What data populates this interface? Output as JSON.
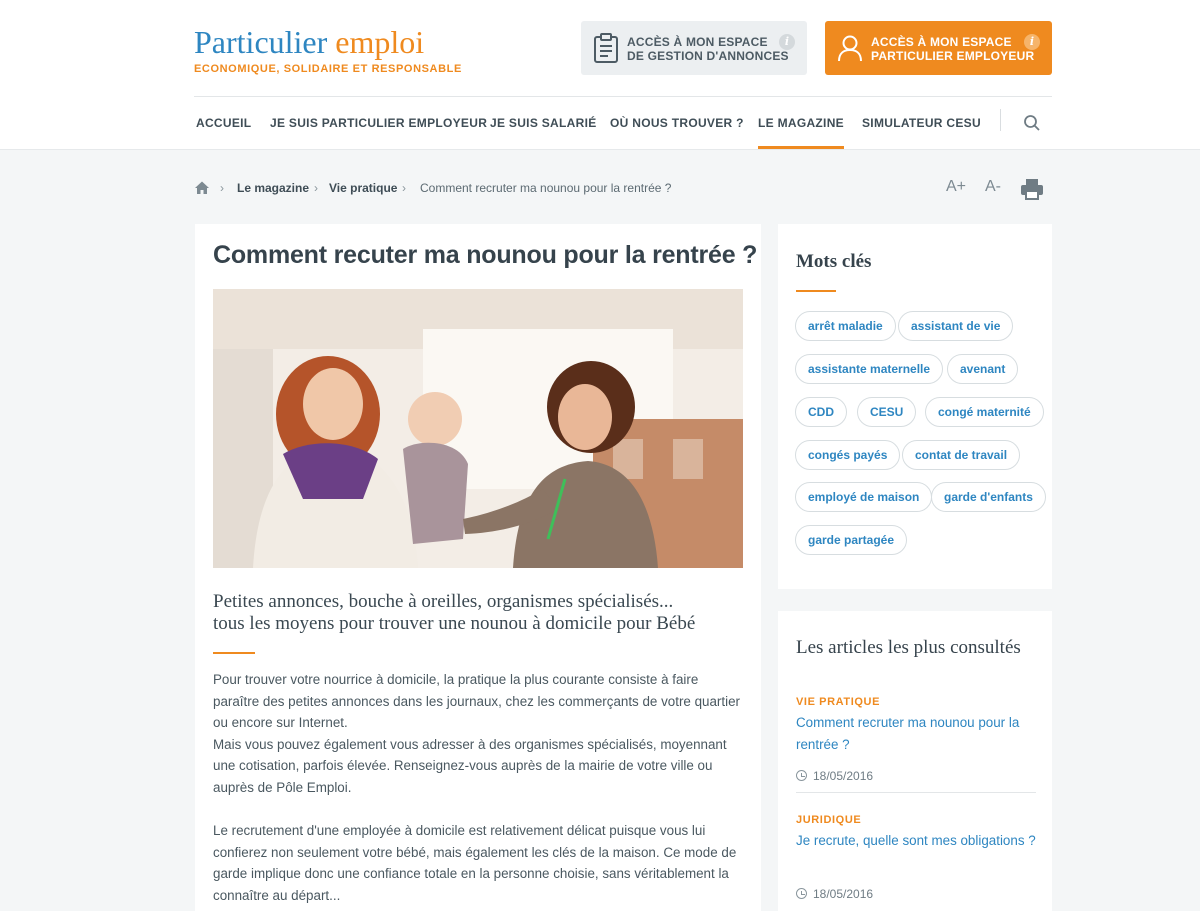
{
  "header": {
    "logo_word1": "Particulier",
    "logo_word2": "emploi",
    "tagline": "ECONOMIQUE, SOLIDAIRE ET RESPONSABLE",
    "btn_annonces_line1": "ACCÈS À MON ESPACE",
    "btn_annonces_line2": "DE GESTION D'ANNONCES",
    "btn_employeur_line1": "ACCÈS À  MON ESPACE",
    "btn_employeur_line2": "PARTICULIER EMPLOYEUR",
    "info_glyph": "i",
    "accent_color": "#ef8a1f",
    "brand_blue": "#2e86c1"
  },
  "nav": {
    "items": [
      {
        "label": "ACCUEIL"
      },
      {
        "label": "JE SUIS PARTICULIER EMPLOYEUR"
      },
      {
        "label": "JE SUIS SALARIÉ"
      },
      {
        "label": "OÙ NOUS TROUVER ?"
      },
      {
        "label": "LE MAGAZINE"
      },
      {
        "label": "SIMULATEUR CESU"
      }
    ],
    "active": "LE MAGAZINE"
  },
  "breadcrumb": {
    "chevron": "›",
    "items": [
      "Le magazine",
      "Vie pratique"
    ],
    "current": "Comment recruter ma nounou pour la rentrée ?"
  },
  "tools": {
    "increase": "A+",
    "decrease": "A-"
  },
  "article": {
    "title": "Comment recuter ma nounou pour la rentrée  ?",
    "lead_line1": "Petites annonces, bouche à oreilles, organismes spécialisés...",
    "lead_line2": "tous les moyens pour trouver une nounou à domicile pour Bébé",
    "body": [
      "Pour trouver votre nourrice à domicile, la pratique la plus courante consiste à faire paraître des petites annonces dans les journaux, chez les commerçants de votre quartier ou encore sur Internet.",
      "Mais vous pouvez également vous adresser à des organismes spécialisés, moyennant une cotisation, parfois élevée. Renseignez-vous auprès de la mairie de votre ville ou auprès de Pôle Emploi.",
      "Le recrutement d'une employée à domicile est relativement délicat puisque vous lui confierez non seulement votre bébé, mais également les clés de la maison. Ce mode de garde implique donc une confiance totale en la personne choisie, sans véritablement la connaître au départ..."
    ]
  },
  "keywords": {
    "title": "Mots clés",
    "tags": [
      "arrêt maladie",
      "assistant de vie",
      "assistante maternelle",
      "avenant",
      "CDD",
      "CESU",
      "congé maternité",
      "congés payés",
      "contat de travail",
      "employé de maison",
      "garde d'enfants",
      "garde partagée"
    ]
  },
  "popular": {
    "title": "Les articles les plus consultés",
    "items": [
      {
        "category": "VIE PRATIQUE",
        "title": "Comment recruter ma nounou pour la rentrée ?",
        "date": "18/05/2016"
      },
      {
        "category": "JURIDIQUE",
        "title": "Je recrute, quelle sont mes obligations ?",
        "date": "18/05/2016"
      }
    ]
  }
}
